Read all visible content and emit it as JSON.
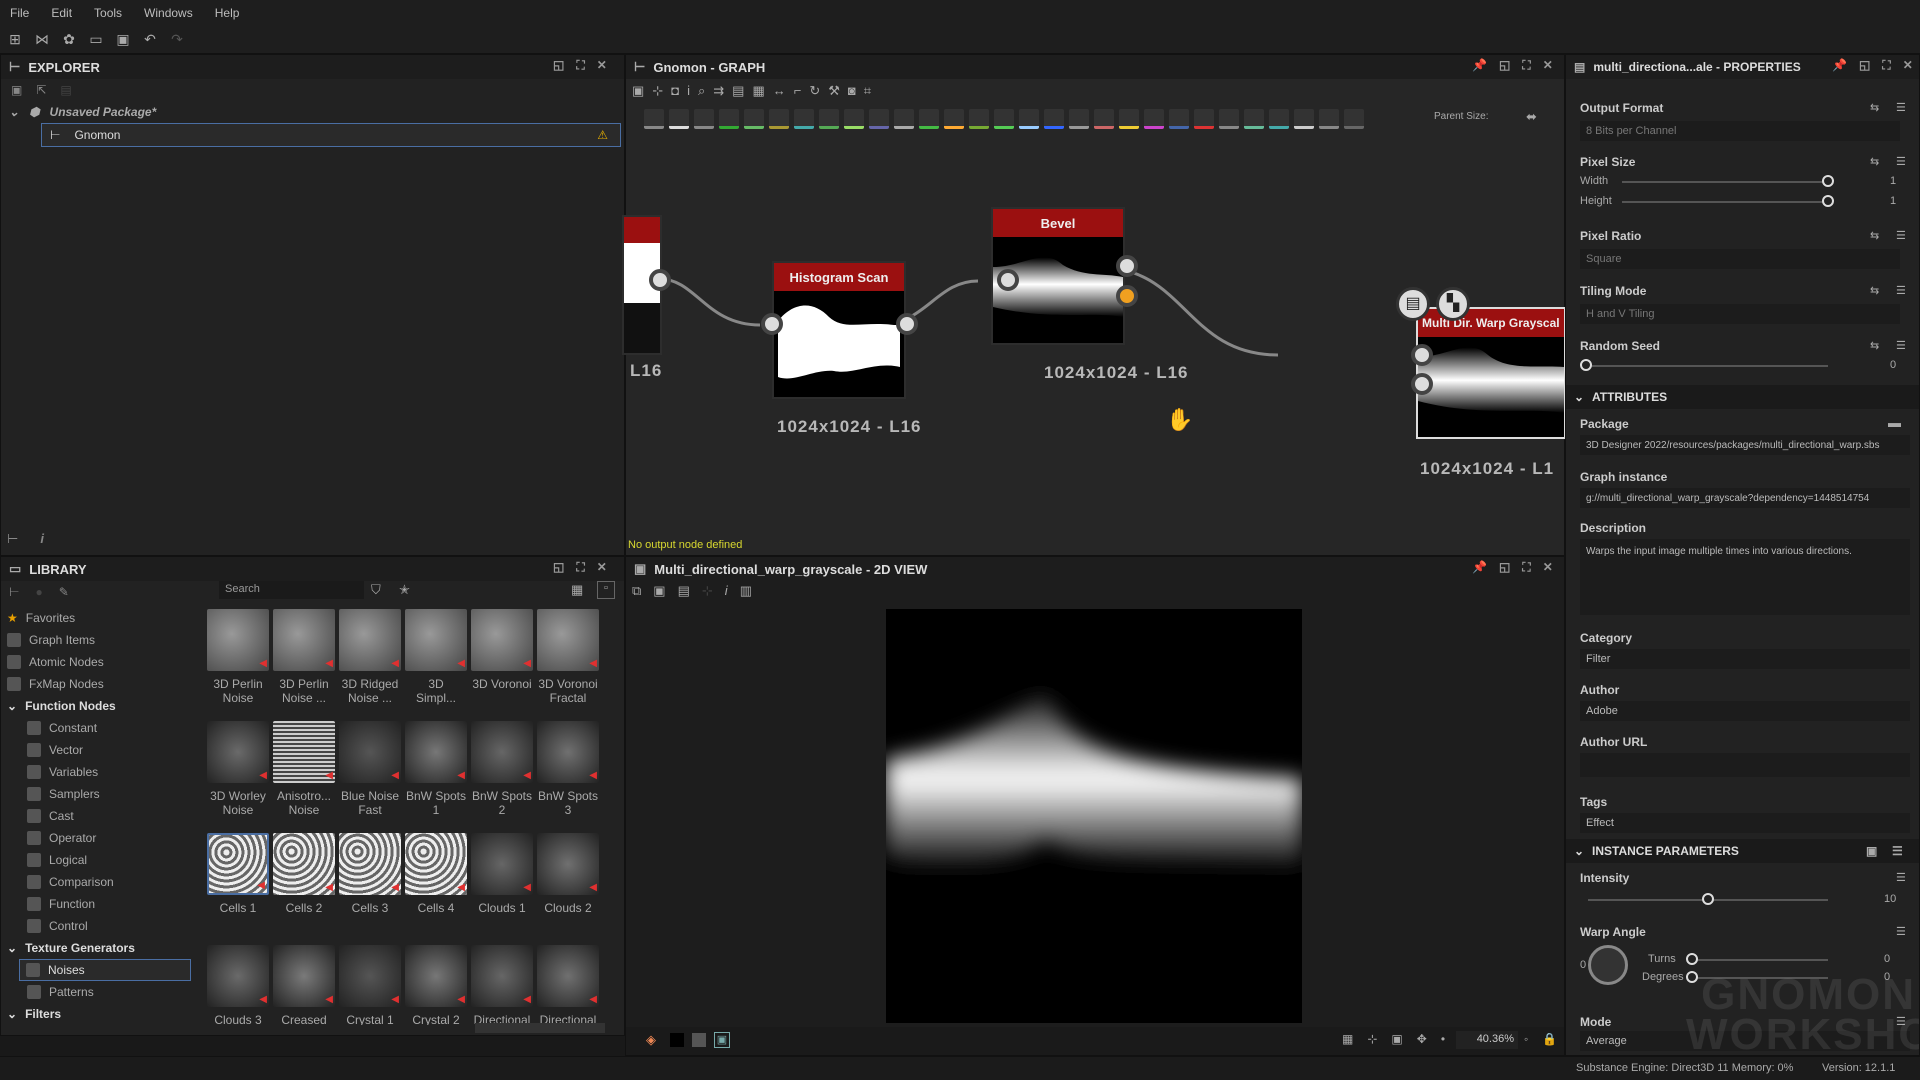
{
  "menu": [
    "File",
    "Edit",
    "Tools",
    "Windows",
    "Help"
  ],
  "explorer": {
    "title": "EXPLORER",
    "package": "Unsaved Package*",
    "graph": "Gnomon"
  },
  "graph": {
    "title": "Gnomon - GRAPH",
    "parent_size_label": "Parent Size:",
    "status": "No output node defined",
    "nodes": {
      "left_res": "L16",
      "histogram": {
        "name": "Histogram Scan",
        "res": "1024x1024 - L16"
      },
      "bevel": {
        "name": "Bevel",
        "res": "1024x1024 - L16"
      },
      "warp": {
        "name": "Multi Dir. Warp Grayscal",
        "res": "1024x1024 - L1"
      }
    }
  },
  "library": {
    "title": "LIBRARY",
    "search_placeholder": "Search",
    "categories": [
      {
        "label": "Favorites",
        "icon": "star-icon"
      },
      {
        "label": "Graph Items",
        "icon": "graph-icon"
      },
      {
        "label": "Atomic Nodes",
        "icon": "atomic-icon"
      },
      {
        "label": "FxMap Nodes",
        "icon": "fxmap-icon"
      }
    ],
    "function_nodes": "Function Nodes",
    "function_items": [
      "Constant",
      "Vector",
      "Variables",
      "Samplers",
      "Cast",
      "Operator",
      "Logical",
      "Comparison",
      "Function",
      "Control"
    ],
    "texture_generators": "Texture Generators",
    "tex_items": [
      "Noises",
      "Patterns"
    ],
    "filters": "Filters",
    "thumbs": [
      [
        "3D Perlin",
        "Noise"
      ],
      [
        "3D Perlin",
        "Noise ..."
      ],
      [
        "3D Ridged",
        "Noise ..."
      ],
      [
        "3D",
        "Simpl..."
      ],
      [
        "3D Voronoi",
        ""
      ],
      [
        "3D Voronoi",
        "Fractal"
      ],
      [
        "3D Worley",
        "Noise"
      ],
      [
        "Anisotro...",
        "Noise"
      ],
      [
        "Blue Noise",
        "Fast"
      ],
      [
        "BnW Spots",
        "1"
      ],
      [
        "BnW Spots",
        "2"
      ],
      [
        "BnW Spots",
        "3"
      ],
      [
        "Cells 1",
        ""
      ],
      [
        "Cells 2",
        ""
      ],
      [
        "Cells 3",
        ""
      ],
      [
        "Cells 4",
        ""
      ],
      [
        "Clouds 1",
        ""
      ],
      [
        "Clouds 2",
        ""
      ],
      [
        "Clouds 3",
        ""
      ],
      [
        "Creased",
        ""
      ],
      [
        "Crystal 1",
        ""
      ],
      [
        "Crystal 2",
        ""
      ],
      [
        "Directional",
        ""
      ],
      [
        "Directional",
        ""
      ]
    ]
  },
  "view2d": {
    "title": "Multi_directional_warp_grayscale - 2D VIEW",
    "zoom": "40.36%"
  },
  "properties": {
    "title": "multi_directiona...ale - PROPERTIES",
    "output_format": {
      "label": "Output Format",
      "value": "8 Bits per Channel"
    },
    "pixel_size": {
      "label": "Pixel Size",
      "width_label": "Width",
      "height_label": "Height",
      "width": "1",
      "height": "1"
    },
    "pixel_ratio": {
      "label": "Pixel Ratio",
      "value": "Square"
    },
    "tiling_mode": {
      "label": "Tiling Mode",
      "value": "H and V Tiling"
    },
    "random_seed": {
      "label": "Random Seed",
      "value": "0"
    },
    "attributes": "ATTRIBUTES",
    "package": {
      "label": "Package",
      "value": "3D Designer 2022/resources/packages/multi_directional_warp.sbs"
    },
    "graph_instance": {
      "label": "Graph instance",
      "value": "g://multi_directional_warp_grayscale?dependency=1448514754"
    },
    "description": {
      "label": "Description",
      "value": "Warps the input image multiple times into various directions."
    },
    "category": {
      "label": "Category",
      "value": "Filter"
    },
    "author": {
      "label": "Author",
      "value": "Adobe"
    },
    "author_url": {
      "label": "Author URL",
      "value": ""
    },
    "tags": {
      "label": "Tags",
      "value": "Effect"
    },
    "instance_params": "INSTANCE PARAMETERS",
    "intensity": {
      "label": "Intensity",
      "value": "10",
      "fraction": 0.5
    },
    "warp_angle": {
      "label": "Warp Angle",
      "dial": "0",
      "turns_label": "Turns",
      "degrees_label": "Degrees",
      "turns": "0",
      "degrees": "0"
    },
    "mode": {
      "label": "Mode",
      "value": "Average"
    }
  },
  "statusbar": {
    "engine": "Substance Engine: Direct3D 11  Memory: 0%",
    "version": "Version: 12.1.1"
  },
  "watermark": "GNOMON WORKSHOP"
}
